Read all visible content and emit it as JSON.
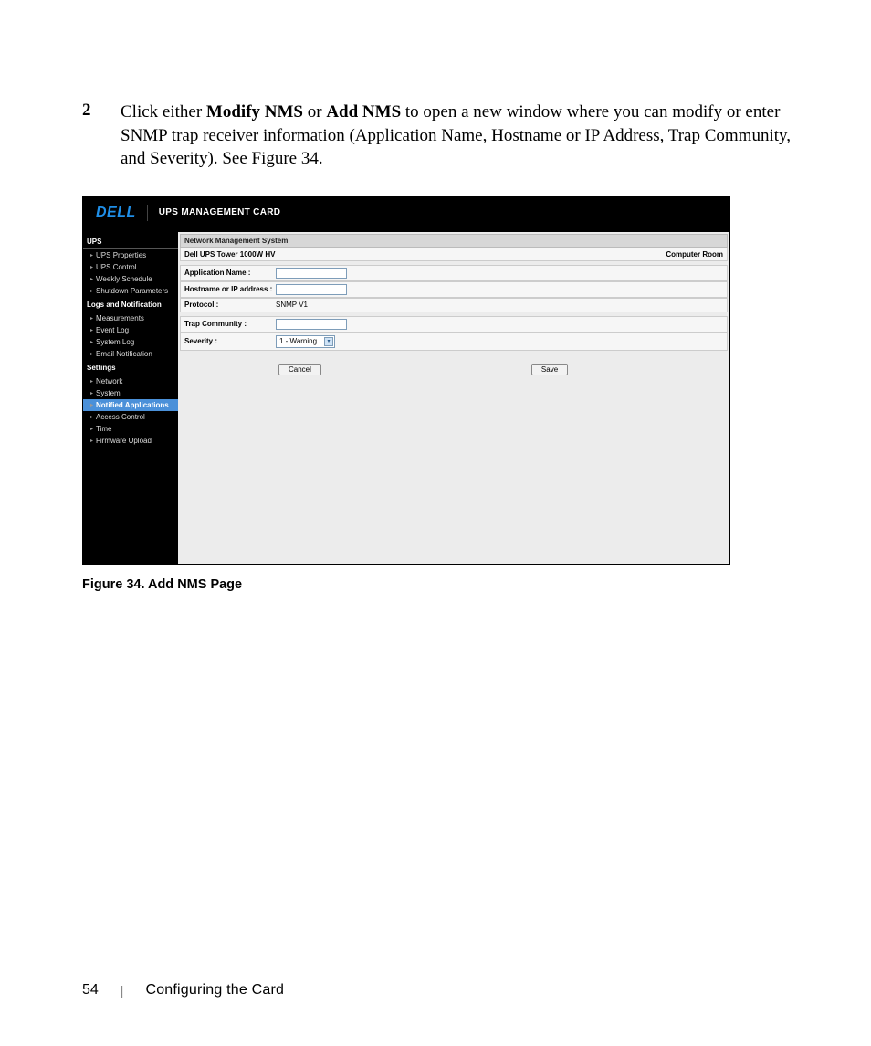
{
  "step": {
    "number": "2",
    "pre": "Click either ",
    "bold1": "Modify NMS",
    "mid1": " or ",
    "bold2": "Add NMS",
    "post": " to open a new window where you can modify or enter SNMP trap receiver information (Application Name, Hostname or IP Address, Trap Community, and Severity). See Figure 34."
  },
  "screenshot": {
    "logo": "DELL",
    "product_title": "UPS MANAGEMENT CARD",
    "sidebar": {
      "group1": {
        "heading": "UPS",
        "items": [
          "UPS Properties",
          "UPS Control",
          "Weekly Schedule",
          "Shutdown Parameters"
        ]
      },
      "group2": {
        "heading": "Logs and Notification",
        "items": [
          "Measurements",
          "Event Log",
          "System Log",
          "Email Notification"
        ]
      },
      "group3": {
        "heading": "Settings",
        "items": [
          "Network",
          "System",
          "Notified Applications",
          "Access Control",
          "Time",
          "Firmware Upload"
        ],
        "active_index": 2
      }
    },
    "content": {
      "section_title": "Network Management System",
      "device_name": "Dell UPS Tower 1000W HV",
      "room": "Computer Room",
      "labels": {
        "app_name": "Application Name :",
        "hostname": "Hostname or IP address :",
        "protocol": "Protocol :",
        "trap": "Trap Community :",
        "severity": "Severity :"
      },
      "values": {
        "app_name": "",
        "hostname": "",
        "protocol": "SNMP V1",
        "trap": "",
        "severity": "1 - Warning"
      },
      "buttons": {
        "cancel": "Cancel",
        "save": "Save"
      }
    }
  },
  "caption": "Figure 34. Add NMS Page",
  "footer": {
    "page": "54",
    "sep": "|",
    "title": "Configuring the Card"
  }
}
